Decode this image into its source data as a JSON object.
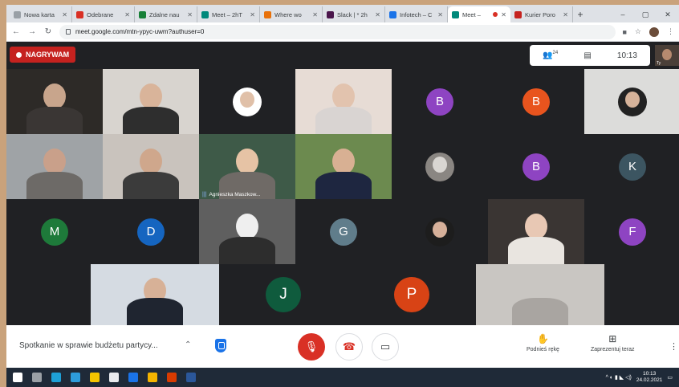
{
  "browser": {
    "tabs": [
      {
        "title": "Nowa karta",
        "icon": "blank-icon",
        "color": "#9aa0a6"
      },
      {
        "title": "Odebrane",
        "icon": "gmail-icon",
        "color": "#d93025"
      },
      {
        "title": "Zdalne nau",
        "icon": "classroom-icon",
        "color": "#188038"
      },
      {
        "title": "Meet – 2hT",
        "icon": "meet-icon",
        "color": "#00897b"
      },
      {
        "title": "Where wo",
        "icon": "pinwheel-icon",
        "color": "#e8710a"
      },
      {
        "title": "Slack | * 2h",
        "icon": "slack-icon",
        "color": "#4a154b"
      },
      {
        "title": "Infotech – C",
        "icon": "infotech-icon",
        "color": "#1a73e8"
      },
      {
        "title": "Meet –",
        "icon": "meet-icon",
        "color": "#00897b",
        "active": true,
        "recording": true
      },
      {
        "title": "Kurier Poro",
        "icon": "kurier-icon",
        "color": "#c5221f"
      }
    ],
    "new_tab_label": "+",
    "window_controls": [
      "–",
      "▢",
      "✕"
    ],
    "url": "meet.google.com/mtn-ypyc-uwm?authuser=0"
  },
  "meet": {
    "recording_label": "NAGRYWAM",
    "participants_count": "24",
    "time": "10:13",
    "self_label": "Ty",
    "tiles": [
      {
        "type": "video",
        "row": 0,
        "col": 0,
        "bg": "#2d2a27",
        "skin": "#c8a58c",
        "shirt": "#3a3634"
      },
      {
        "type": "video",
        "row": 0,
        "col": 1,
        "bg": "#d8d4cf",
        "skin": "#d9b49a",
        "shirt": "#2e2e2e"
      },
      {
        "type": "video",
        "row": 0,
        "col": 2,
        "bg": "#202124",
        "skin": "#e0c0a8",
        "shirt": "#ffffff",
        "small": true
      },
      {
        "type": "video",
        "row": 0,
        "col": 3,
        "bg": "#e7dcd5",
        "skin": "#e2c3ae",
        "shirt": "#d9d4d2"
      },
      {
        "type": "avatar",
        "row": 0,
        "col": 4,
        "letter": "B",
        "color": "#8e44c2"
      },
      {
        "type": "avatar",
        "row": 0,
        "col": 5,
        "letter": "B",
        "color": "#e8541e"
      },
      {
        "type": "video",
        "row": 0,
        "col": 6,
        "bg": "#dcdcda",
        "skin": "#d6b39a",
        "shirt": "#222222",
        "small": true
      },
      {
        "type": "video",
        "row": 1,
        "col": 0,
        "bg": "#9fa3a6",
        "skin": "#c9a08a",
        "shirt": "#6d6a67"
      },
      {
        "type": "video",
        "row": 1,
        "col": 1,
        "bg": "#c9c3bd",
        "skin": "#cfa78c",
        "shirt": "#3b3b3b"
      },
      {
        "type": "video",
        "row": 1,
        "col": 2,
        "bg": "#3e5a48",
        "skin": "#e6c3a5",
        "shirt": "#6f6a66",
        "name": "Agnieszka Maszkow..."
      },
      {
        "type": "video",
        "row": 1,
        "col": 3,
        "bg": "#6c8a4f",
        "skin": "#d8b093",
        "shirt": "#1e2640"
      },
      {
        "type": "video",
        "row": 1,
        "col": 4,
        "bg": "#202124",
        "skin": "#d9d6d2",
        "shirt": "#8a8682",
        "small": true
      },
      {
        "type": "avatar",
        "row": 1,
        "col": 5,
        "letter": "B",
        "color": "#8e44c2"
      },
      {
        "type": "avatar",
        "row": 1,
        "col": 6,
        "letter": "K",
        "color": "#3c5561"
      },
      {
        "type": "avatar",
        "row": 2,
        "col": 0,
        "letter": "M",
        "color": "#1e7a3a"
      },
      {
        "type": "avatar",
        "row": 2,
        "col": 1,
        "letter": "D",
        "color": "#1565c0"
      },
      {
        "type": "video",
        "row": 2,
        "col": 2,
        "bg": "#5f5f5f",
        "skin": "#efefef",
        "shirt": "#2d2d2d"
      },
      {
        "type": "avatar",
        "row": 2,
        "col": 3,
        "letter": "G",
        "color": "#607d8b"
      },
      {
        "type": "video",
        "row": 2,
        "col": 4,
        "bg": "#202124",
        "skin": "#d6b09a",
        "shirt": "#1d1d1d",
        "small": true
      },
      {
        "type": "video",
        "row": 2,
        "col": 5,
        "bg": "#3a3533",
        "skin": "#e8c8b4",
        "shirt": "#e9e5e0"
      },
      {
        "type": "avatar",
        "row": 2,
        "col": 6,
        "letter": "F",
        "color": "#8e44c2"
      }
    ],
    "bottom_tiles": [
      {
        "type": "video",
        "bg": "#d5dbe2",
        "skin": "#d7b197",
        "shirt": "#1f2530"
      },
      {
        "type": "avatar",
        "letter": "J",
        "color": "#0f5b3d"
      },
      {
        "type": "avatar",
        "letter": "P",
        "color": "#d84315"
      },
      {
        "type": "video",
        "bg": "#c9c6c2",
        "skin": "#c9c6c2",
        "shirt": "#a9a5a1"
      }
    ]
  },
  "controls": {
    "meeting_title": "Spotkanie w sprawie budżetu partycy...",
    "chevron": "⌃",
    "raise_hand_label": "Podnieś rękę",
    "present_label": "Zaprezentuj teraz",
    "more": "⋮"
  },
  "taskbar": {
    "time": "10:13",
    "date": "24.02.2021",
    "apps": [
      "#ffffff",
      "#9aa0a6",
      "#1ea0d7",
      "#2d9cdb",
      "#f5c400",
      "#e8eaed",
      "#1a73e8",
      "#f4b400",
      "#d83b01",
      "#2b579a"
    ]
  }
}
